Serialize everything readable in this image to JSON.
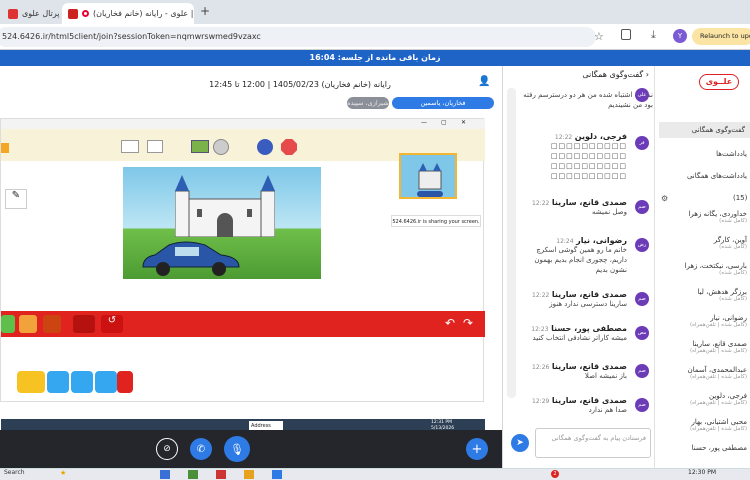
{
  "browser": {
    "tabs": [
      {
        "label": "پرتال علوی"
      },
      {
        "label": "علوی - رایانه (خانم فخاریان) |"
      }
    ],
    "new_tab": "+",
    "url": "524.6426.ir/html5client/join?sessionToken=nqmwrswmed9vzaxc",
    "avatar_letter": "Y",
    "relaunch_label": "Relaunch to update"
  },
  "session": {
    "timer_text": "زمان باقی مانده از جلسه: 16:04"
  },
  "header": {
    "meeting_title": "رایانه (خانم فخاریان) 1405/02/23 | 12:00 تا 12:45",
    "presenter_badge": "فخاریان، یاسمین",
    "other_badge": "شیرازی، سپیده"
  },
  "shared_screen": {
    "sharing_notice": "524.6426.ir is sharing your screen.",
    "clock_time": "12:31 PM",
    "clock_date": "5/13/2026",
    "search_hint": "Address"
  },
  "chat": {
    "title": "گفت‌وگوی همگانی",
    "back_icon": "‹",
    "messages": [
      {
        "initials": "علی",
        "name": "",
        "time": "",
        "text": "نمیخته اشتباه شده من هر دو درسترسم رفته بود من نشیندیم"
      },
      {
        "initials": "فر",
        "name": "فرجی، دلوین",
        "time": "12:22",
        "text": "□□□□□□□□□□ □□□□□□□□□□ □□□□□□□□□□ □□□□□□□□□□"
      },
      {
        "initials": "صم",
        "name": "صمدی قانع، سارینا",
        "time": "12:22",
        "text": "وصل نمیشه"
      },
      {
        "initials": "رض",
        "name": "رضوانی، نیار",
        "time": "12:24",
        "text": "خانم ما رو همین گوشی اسکرچ داریم، چجوری انجام بدیم بهمون نشون بدیم"
      },
      {
        "initials": "صم",
        "name": "صمدی قانع، سارینا",
        "time": "12:22",
        "text": "سارینا دسترسی ندارد هنوز"
      },
      {
        "initials": "مص",
        "name": "مصطفی پور، حسنا",
        "time": "12:23",
        "text": "میشه کاراتر نشادفی انتخاب کنید"
      },
      {
        "initials": "صم",
        "name": "صمدی قانع، سارینا",
        "time": "12:26",
        "text": "باز نمیشه اصلا"
      },
      {
        "initials": "صم",
        "name": "صمدی قانع، سارینا",
        "time": "12:29",
        "text": "صدا هم ندارد"
      }
    ],
    "input_placeholder": "فرستادن پیام به گفت‌وگوی همگانی"
  },
  "sidebar": {
    "logo_text": "علــوی",
    "nav_items": [
      {
        "label": "گفت‌وگوی همگانی"
      },
      {
        "label": "یادداشت‌ها"
      },
      {
        "label": "یادداشت‌های همگانی"
      }
    ],
    "users_count": "(15)",
    "users": [
      {
        "name": "خداوردی، یگانه زهرا",
        "status": "(کامل شده)"
      },
      {
        "name": "آوین، کارگر",
        "status": "(کامل شده)"
      },
      {
        "name": "بارسی، نیکتخت، زهرا",
        "status": "(کامل شده)"
      },
      {
        "name": "برزگر هدهش، لیا",
        "status": "(کامل شده)"
      },
      {
        "name": "رضوانی، نیار",
        "status": "(کامل شده | تلفن‌همراه)"
      },
      {
        "name": "صمدی قانع، سارینا",
        "status": "(کامل شده | تلفن‌همراه)"
      },
      {
        "name": "عبدالمحمدی، آسمان",
        "status": "(کامل شده | تلفن‌همراه)"
      },
      {
        "name": "فرجی، دلوین",
        "status": "(کامل شده | تلفن‌همراه)"
      },
      {
        "name": "محبی اشتیانی، بهار",
        "status": "(کامل شده | تلفن‌همراه)"
      },
      {
        "name": "مصطفی پور، حسنا",
        "status": ""
      }
    ]
  },
  "taskbar": {
    "search_label": "Search",
    "time": "12:30 PM",
    "notif_count": "2"
  },
  "colors": {
    "banner": "#1e63c6",
    "scratch_red": "#e0231e",
    "accent_blue": "#2f7be6",
    "chat_avatar": "#6c3cb8"
  }
}
